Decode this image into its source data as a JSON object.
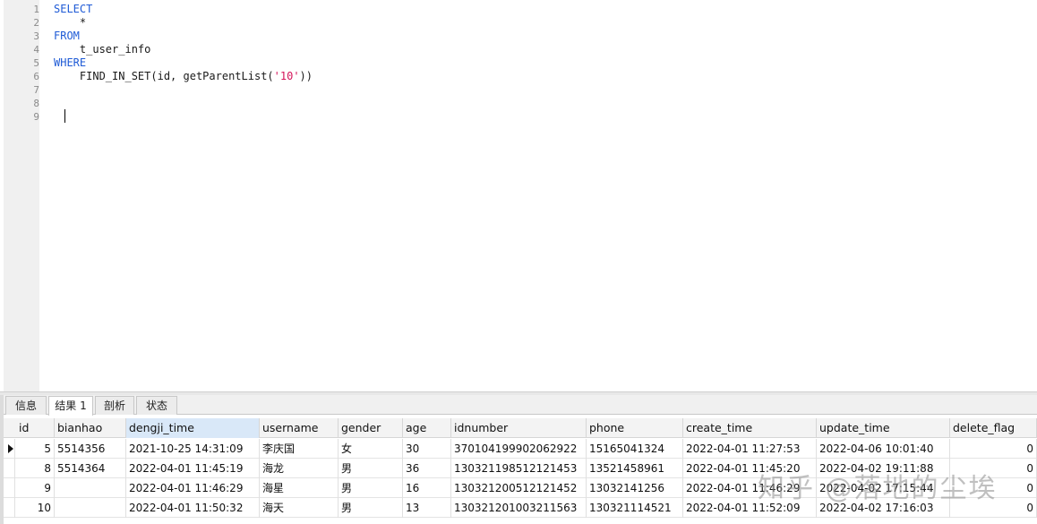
{
  "editor": {
    "line_numbers": [
      "1",
      "2",
      "3",
      "4",
      "5",
      "6",
      "7",
      "8",
      "9"
    ],
    "lines": [
      {
        "kw": "SELECT",
        "text": ""
      },
      {
        "kw": "",
        "text": "    *"
      },
      {
        "kw": "FROM",
        "text": ""
      },
      {
        "kw": "",
        "text": "    t_user_info"
      },
      {
        "kw": "WHERE",
        "text": ""
      },
      {
        "kw": "",
        "text": "    FIND_IN_SET(id, getParentList(",
        "str": "'10'",
        "tail": "))"
      }
    ]
  },
  "tabs": [
    "信息",
    "结果 1",
    "剖析",
    "状态"
  ],
  "grid": {
    "columns": [
      "id",
      "bianhao",
      "dengji_time",
      "username",
      "gender",
      "age",
      "idnumber",
      "phone",
      "create_time",
      "update_time",
      "delete_flag"
    ],
    "rows": [
      [
        "5",
        "5514356",
        "2021-10-25 14:31:09",
        "李庆国",
        "女",
        "30",
        "370104199902062922",
        "15165041324",
        "2022-04-01 11:27:53",
        "2022-04-06 10:01:40",
        "0"
      ],
      [
        "8",
        "5514364",
        "2022-04-01 11:45:19",
        "海龙",
        "男",
        "36",
        "130321198512121453",
        "13521458961",
        "2022-04-01 11:45:20",
        "2022-04-02 19:11:88",
        "0"
      ],
      [
        "9",
        "",
        "2022-04-01 11:46:29",
        "海星",
        "男",
        "16",
        "130321200512121452",
        "13032141256",
        "2022-04-01 11:46:29",
        "2022-04-02 17:15:44",
        "0"
      ],
      [
        "10",
        "",
        "2022-04-01 11:50:32",
        "海天",
        "男",
        "13",
        "130321201003211563",
        "130321114521",
        "2022-04-01 11:52:09",
        "2022-04-02 17:16:03",
        "0"
      ]
    ]
  },
  "watermark": "知乎 @落地的尘埃"
}
